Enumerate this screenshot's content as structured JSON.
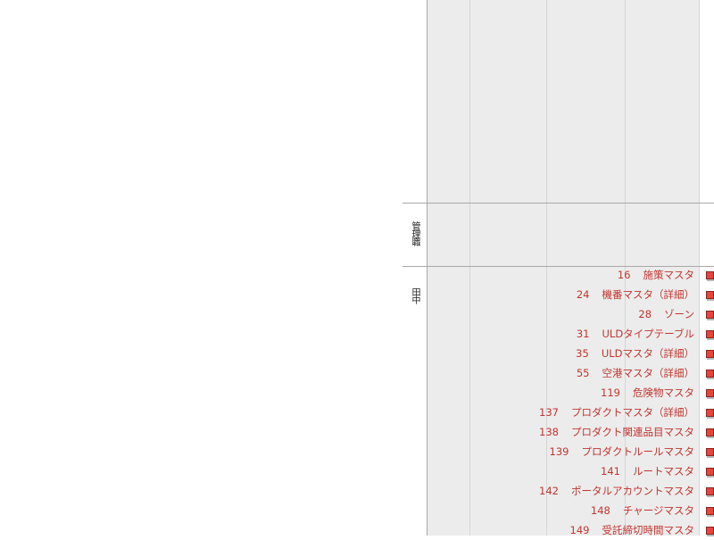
{
  "lanes": {
    "manager": "管理職",
    "tanaka": "田中"
  },
  "items": [
    {
      "num": "16",
      "name": "施策マスタ"
    },
    {
      "num": "24",
      "name": "機番マスタ（詳細）"
    },
    {
      "num": "28",
      "name": "ゾーン"
    },
    {
      "num": "31",
      "name": "ULDタイプテーブル"
    },
    {
      "num": "35",
      "name": "ULDマスタ（詳細）"
    },
    {
      "num": "55",
      "name": "空港マスタ（詳細）"
    },
    {
      "num": "119",
      "name": "危険物マスタ"
    },
    {
      "num": "137",
      "name": "プロダクトマスタ（詳細）"
    },
    {
      "num": "138",
      "name": "プロダクト関連品目マスタ"
    },
    {
      "num": "139",
      "name": "プロダクトルールマスタ"
    },
    {
      "num": "141",
      "name": "ルートマスタ"
    },
    {
      "num": "142",
      "name": "ポータルアカウントマスタ"
    },
    {
      "num": "148",
      "name": "チャージマスタ"
    },
    {
      "num": "149",
      "name": "受託締切時間マスタ"
    }
  ],
  "colors": {
    "link": "#c2352f",
    "flag": "#e2463f",
    "lane_bg": "#ececec"
  }
}
